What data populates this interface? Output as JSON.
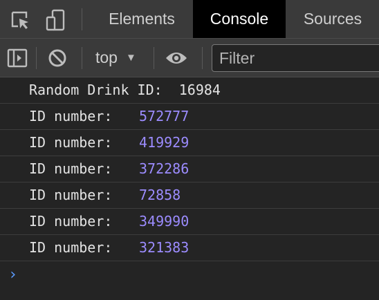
{
  "tabs": [
    {
      "label": "Elements",
      "active": false
    },
    {
      "label": "Console",
      "active": true
    },
    {
      "label": "Sources",
      "active": false
    }
  ],
  "icons": {
    "inspect": "inspect-element-icon",
    "device": "device-toolbar-icon",
    "sidebar": "show-sidebar-icon",
    "clear": "clear-console-icon",
    "eye": "live-expression-icon"
  },
  "toolbar": {
    "context": "top",
    "filter_placeholder": "Filter"
  },
  "console": {
    "header": "Random Drink ID:  16984",
    "rows": [
      {
        "label": "ID number:",
        "value": "572777"
      },
      {
        "label": "ID number:",
        "value": "419929"
      },
      {
        "label": "ID number:",
        "value": "372286"
      },
      {
        "label": "ID number:",
        "value": "72858"
      },
      {
        "label": "ID number:",
        "value": "349990"
      },
      {
        "label": "ID number:",
        "value": "321383"
      }
    ],
    "prompt": "›"
  },
  "colors": {
    "background": "#242424",
    "toolbar": "#3a3a3a",
    "number": "#9c8cff",
    "prompt": "#5b9cff"
  }
}
